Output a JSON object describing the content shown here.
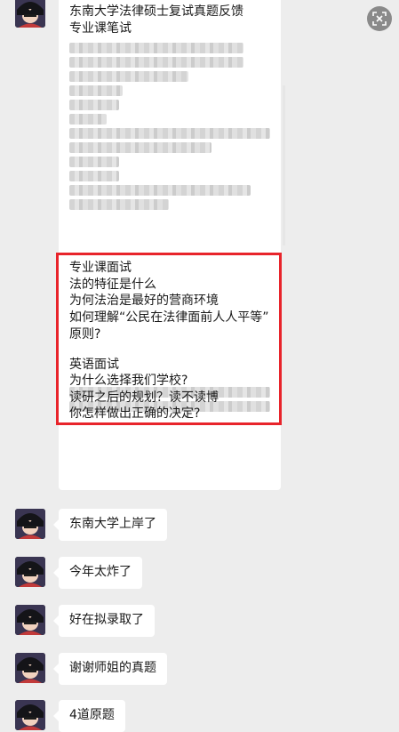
{
  "messages": [
    {
      "type": "long",
      "lines_top": [
        "东南大学法律硕士复试真题反馈",
        "专业课笔试"
      ],
      "highlight_lines": [
        "专业课面试",
        "法的特征是什么",
        "为何法治是最好的营商环境",
        "如何理解“公民在法律面前人人平等”",
        "原则?",
        "",
        "英语面试",
        "为什么选择我们学校?",
        "读研之后的规划？读不读博",
        "你怎样做出正确的决定?"
      ]
    },
    {
      "type": "short",
      "text": "东南大学上岸了"
    },
    {
      "type": "short",
      "text": "今年太炸了"
    },
    {
      "type": "short",
      "text": "好在拟录取了"
    },
    {
      "type": "short",
      "text": "谢谢师姐的真题"
    },
    {
      "type": "short",
      "text": "4道原题"
    }
  ],
  "colors": {
    "highlight_border": "#e8242b",
    "background": "#ededed",
    "bubble": "#ffffff"
  },
  "icons": {
    "top_right": "close-scan-icon"
  }
}
